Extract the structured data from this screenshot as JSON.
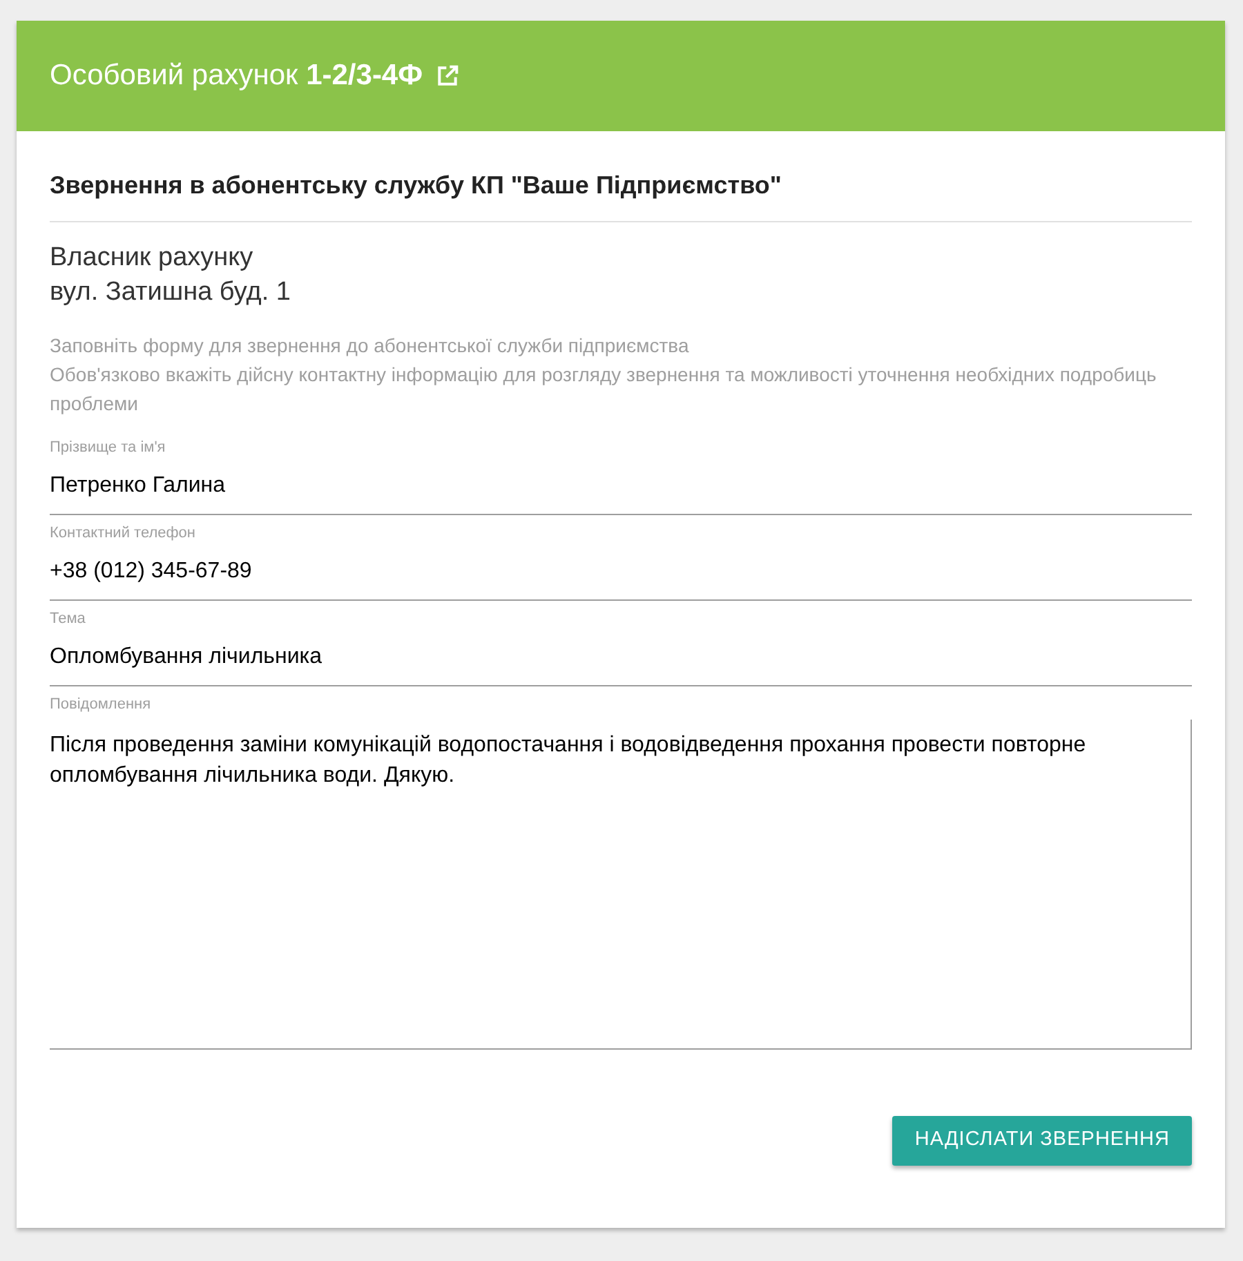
{
  "header": {
    "title": "Особовий рахунок **1-2/3-4Ф**"
  },
  "heading": "Звернення в абонентську службу КП \"Ваше Підприємство\"",
  "owner": "Власник рахунку",
  "address": "вул. Затишна буд. 1",
  "instructions": [
    "Заповніть форму для звернення до абонентської служби підприємства",
    "Обов'язково вкажіть дійсну контактну інформацію для розгляду звернення та можливості уточнення необхідних подробиць проблеми"
  ],
  "fields": [
    {
      "kind": "input",
      "label": "Прізвище та ім'я",
      "value": "Петренко Галина"
    },
    {
      "kind": "input",
      "label": "Контактний телефон",
      "value": "+38 (012) 345-67-89"
    },
    {
      "kind": "input",
      "label": "Тема",
      "value": "Опломбування лічильника"
    },
    {
      "kind": "textarea",
      "label": "Повідомлення",
      "value": "Після проведення заміни комунікацій водопостачання і водовідведення прохання провести повторне опломбування лічильника води. Дякую."
    }
  ],
  "submit_button": "НАДІСЛАТИ ЗВЕРНЕННЯ"
}
